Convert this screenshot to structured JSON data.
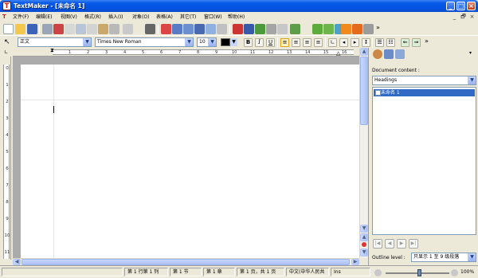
{
  "window": {
    "title": "TextMaker - [未命名 1]",
    "app_icon_letter": "T",
    "controls": {
      "minimize": "_",
      "maximize": "□",
      "close": "×"
    }
  },
  "menu": {
    "doc_icon_letter": "T",
    "items": [
      "文件(F)",
      "编辑(E)",
      "视图(V)",
      "格式(R)",
      "插入(I)",
      "对象(O)",
      "表格(A)",
      "其它(T)",
      "窗口(W)",
      "帮助(H)"
    ],
    "doc_controls": [
      "_",
      "🗗",
      "×"
    ]
  },
  "toolbar": {
    "overflow": "»"
  },
  "format_bar": {
    "style_value": "正文",
    "font_value": "Times New Roman",
    "size_value": "10",
    "bold": "B",
    "italic": "I",
    "underline": "U",
    "overflow": "»"
  },
  "ruler": {
    "h_numbers": [
      "1",
      "2",
      "3",
      "4",
      "5",
      "6",
      "7",
      "8",
      "9",
      "10",
      "11",
      "12",
      "13",
      "14",
      "15",
      "16"
    ],
    "v_numbers": [
      "0",
      "1",
      "2",
      "3",
      "4",
      "5",
      "6",
      "7",
      "8",
      "9",
      "10",
      "11"
    ]
  },
  "panel": {
    "document_content_label": "Document content :",
    "view_select": "Headings",
    "outline_items": [
      {
        "label": "未命名 1",
        "selected": true
      }
    ],
    "outline_level_label": "Outline level :",
    "outline_level_value": "只显示 1 至 9 级段落"
  },
  "status": {
    "position": "第 1 行第 1 列",
    "section": "第 1 节",
    "chapter": "第 1 章",
    "page": "第 1 页，共 1 页",
    "language": "中文(中华人民共",
    "mode": "Ins",
    "zoom": "100%"
  },
  "colors": {
    "title_bar": "#0054E3",
    "selection": "#316AC5",
    "close_button": "#C6391A"
  }
}
